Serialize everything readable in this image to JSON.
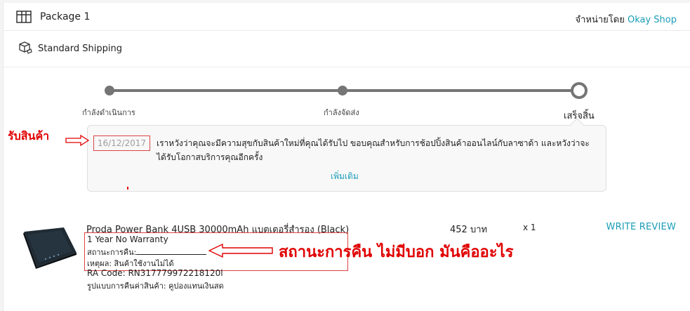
{
  "package": {
    "title": "Package 1",
    "seller_prefix": "จำหน่ายโดย",
    "seller_name": "Okay Shop",
    "icon": "package-icon"
  },
  "shipping": {
    "label": "Standard Shipping",
    "icon": "truck-icon"
  },
  "progress": {
    "steps": [
      {
        "label": "กำลังดำเนินการ"
      },
      {
        "label": "กำลังจัดส่ง"
      },
      {
        "label": "เสร็จสิ้น"
      }
    ]
  },
  "status": {
    "date": "16/12/2017",
    "message": "เราหวังว่าคุณจะมีความสุขกับสินค้าใหม่ที่คุณได้รับไป ขอบคุณสำหรับการช้อปปิ้งสินค้าออนไลน์กับลาซาด้า และหวังว่าจะได้รับโอกาสบริการคุณอีกครั้ง",
    "more_label": "เพิ่มเติม"
  },
  "annotations": {
    "received": "รับสินค้า",
    "question": "สถานะการคืน  ไม่มีบอก    มันคืออะไร",
    "color": "#e00000"
  },
  "product": {
    "name": "Proda Power Bank 4USB 30000mAh แบตเตอรี่สำรอง (Black)",
    "price": "452 บาท",
    "qty": "x 1",
    "review_label": "WRITE REVIEW",
    "warranty": "1 Year No Warranty",
    "return_status_label": "สถานะการคืน:",
    "reason": "เหตุผล: สินค้าใช้งานไม่ได้",
    "ra_code": "RA Code: RN317779972218120l",
    "refund_type": "รูปแบบการคืนค่าสินค้า: คูปองแทนเงินสด"
  },
  "colors": {
    "link": "#1a9cb7",
    "progress": "#757575"
  }
}
